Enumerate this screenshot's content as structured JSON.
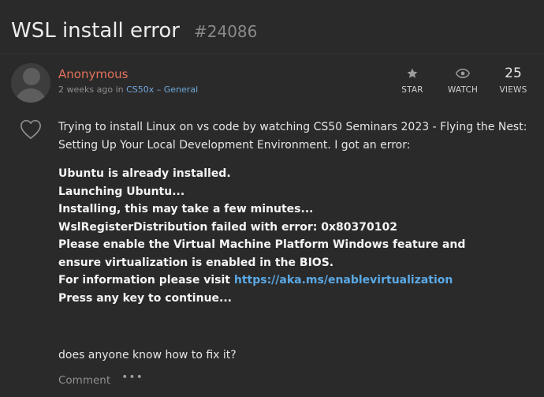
{
  "post": {
    "title": "WSL install error",
    "id": "#24086"
  },
  "author": {
    "name": "Anonymous",
    "time": "2 weeks ago",
    "in_text": "in",
    "category": "CS50x – General"
  },
  "stats": {
    "star_label": "STAR",
    "watch_label": "WATCH",
    "views_count": "25",
    "views_label": "VIEWS"
  },
  "body": {
    "intro": "Trying to install Linux on vs code by watching CS50 Seminars 2023 - Flying the Nest: Setting Up Your Local Development Environment. I got an error:",
    "lines": [
      "Ubuntu is already installed.",
      "Launching Ubuntu...",
      "Installing, this may take a few minutes...",
      "WslRegisterDistribution failed with error: 0x80370102",
      "Please enable the Virtual Machine Platform Windows feature and ensure virtualization is enabled in the BIOS."
    ],
    "info_prefix": "For information please visit",
    "info_link": "https://aka.ms/enablevirtualization",
    "final_line": "Press any key to continue...",
    "question": "does anyone know how to fix it?"
  },
  "actions": {
    "comment_label": "Comment",
    "more_label": "•••"
  },
  "colors": {
    "background": "#2b2a2a",
    "author": "#e2725b",
    "link": "#5aa9e6",
    "muted": "#8f8f8f"
  },
  "icons": {
    "star": "star-icon",
    "watch": "eye-icon",
    "like": "heart-icon",
    "avatar": "avatar-placeholder"
  }
}
